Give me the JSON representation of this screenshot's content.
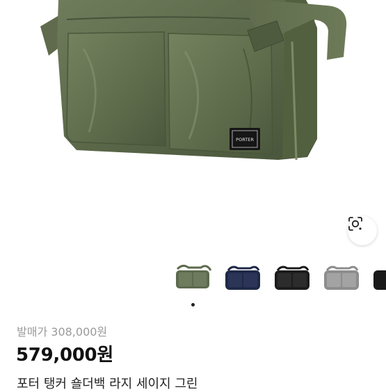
{
  "product": {
    "image_alt": "Porter Tanker shoulder bag large, sage green",
    "brand_tag": "PORTER",
    "original_price_label": "발매가",
    "original_price": "308,000원",
    "price": "579,000원",
    "title": "포터 탱커 숄더백 라지 세이지 그린"
  },
  "thumbnails": [
    {
      "name": "thumb-sage-green",
      "color": "#5d6a4e"
    },
    {
      "name": "thumb-navy",
      "color": "#1f2947"
    },
    {
      "name": "thumb-black",
      "color": "#1c1c1c"
    },
    {
      "name": "thumb-silver-gray",
      "color": "#8d8d8d"
    },
    {
      "name": "thumb-black-2",
      "color": "#1a1a1a"
    }
  ],
  "carousel": {
    "active_index": 0,
    "total": 1
  },
  "icons": {
    "lens": "lens-search-icon"
  }
}
